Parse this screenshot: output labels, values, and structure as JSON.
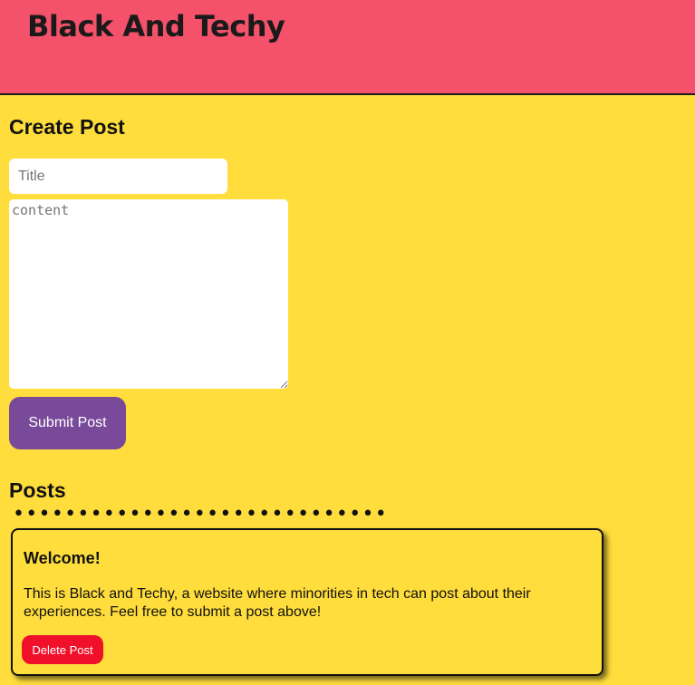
{
  "header": {
    "title": "Black And Techy"
  },
  "create_post": {
    "heading": "Create Post",
    "title_input": {
      "value": "",
      "placeholder": "Title"
    },
    "content_textarea": {
      "value": "",
      "placeholder": "content"
    },
    "submit_label": "Submit Post"
  },
  "posts": {
    "heading": "Posts",
    "items": [
      {
        "title": "Welcome!",
        "content": "This is Black and Techy, a website where minorities in tech can post about their experiences. Feel free to submit a post above!",
        "delete_label": "Delete Post"
      }
    ]
  },
  "colors": {
    "page_background": "#ffdd3c",
    "header_background": "#f4516a",
    "submit_button": "#7a4a9a",
    "delete_button": "#f0102a"
  }
}
